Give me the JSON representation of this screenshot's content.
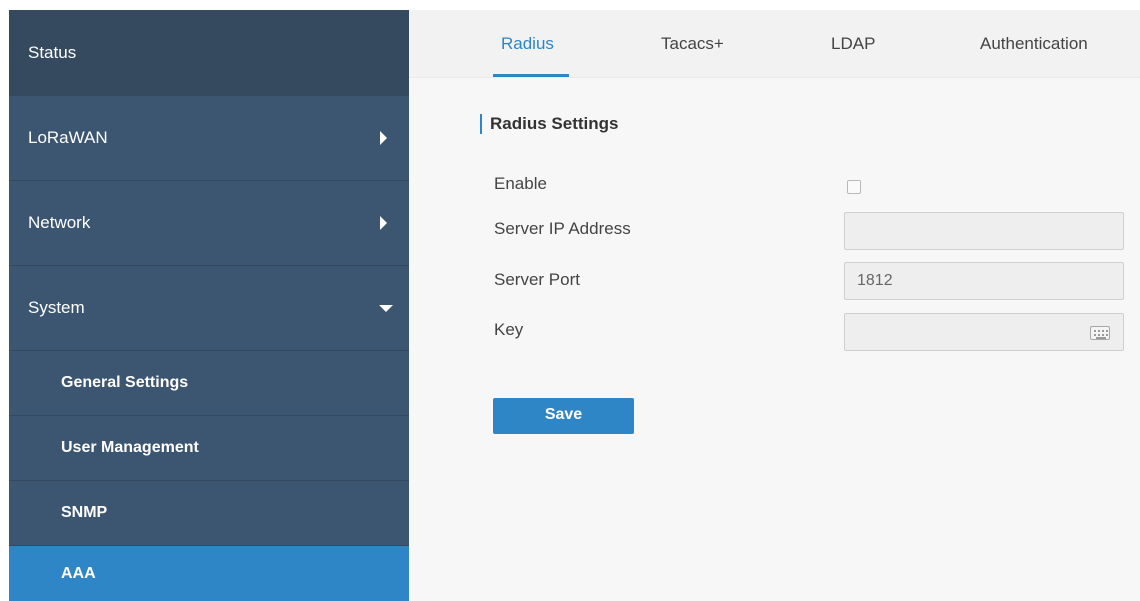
{
  "sidebar": {
    "items": [
      {
        "label": "Status"
      },
      {
        "label": "LoRaWAN"
      },
      {
        "label": "Network"
      },
      {
        "label": "System"
      },
      {
        "label": "General Settings"
      },
      {
        "label": "User Management"
      },
      {
        "label": "SNMP"
      },
      {
        "label": "AAA"
      }
    ],
    "active_item": "AAA"
  },
  "tabs": [
    {
      "label": "Radius",
      "active": true
    },
    {
      "label": "Tacacs+",
      "active": false
    },
    {
      "label": "LDAP",
      "active": false
    },
    {
      "label": "Authentication",
      "active": false
    }
  ],
  "form": {
    "section_title": "Radius Settings",
    "enable_label": "Enable",
    "enable_checked": false,
    "server_ip_label": "Server IP Address",
    "server_ip_value": "",
    "server_port_label": "Server Port",
    "server_port_value": "1812",
    "key_label": "Key",
    "key_value": "",
    "save_label": "Save"
  },
  "colors": {
    "sidebar_bg": "#3c5571",
    "sidebar_top_bg": "#35495f",
    "accent": "#2e86c6",
    "main_bg": "#f7f7f7"
  }
}
